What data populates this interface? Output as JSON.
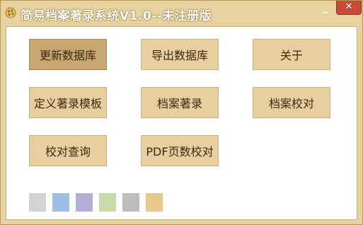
{
  "window": {
    "title": "简易档案著录系统V1.0--未注册版",
    "minimize_label": "_",
    "close_label": "✕"
  },
  "buttons": [
    {
      "label": "更新数据库",
      "active": true
    },
    {
      "label": "导出数据库"
    },
    {
      "label": "关于"
    },
    {
      "label": "定义著录模板"
    },
    {
      "label": "档案著录"
    },
    {
      "label": "档案校对"
    },
    {
      "label": "校对查询"
    },
    {
      "label": "PDF页数校对"
    }
  ],
  "theme_swatches": [
    {
      "color": "#d3d3d3"
    },
    {
      "color": "#9dbfe6"
    },
    {
      "color": "#b3aed6"
    },
    {
      "color": "#c9dba6"
    },
    {
      "color": "#bdbdbd"
    },
    {
      "color": "#e8c98c"
    }
  ]
}
